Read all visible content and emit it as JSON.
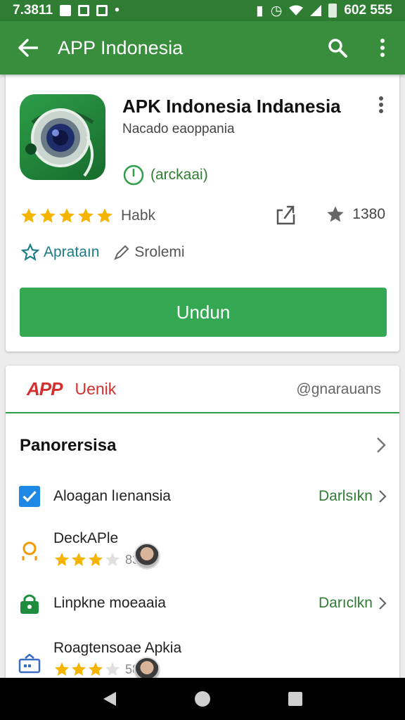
{
  "status_bar": {
    "left_text": "7.3811",
    "right_text": "602 555"
  },
  "app_bar": {
    "title": "APP Indonesia",
    "icons": [
      "back-arrow-icon",
      "search-icon",
      "more-vert-icon"
    ]
  },
  "app": {
    "name": "APK Indonesia Indanesia",
    "developer": "Nacado eaoppania",
    "install_state": "(arckaai)",
    "rating_label": "Habk",
    "stars": 5,
    "review_count": "1380",
    "category": "Aprataın",
    "size_tag": "Srolemi",
    "download_label": "Undun"
  },
  "brand": {
    "logo": "APP",
    "name": "Uenik",
    "handle": "@gnarauans"
  },
  "section": {
    "title": "Panorersisa"
  },
  "list": [
    {
      "label": "Aloagan lıenansia",
      "action": "Darlsıkn",
      "icon": "checkbox-icon"
    },
    {
      "label": "DeckAPle",
      "score": "83",
      "stars": 3,
      "icon": "person-icon"
    },
    {
      "label": "Linpkne moeaaia",
      "action": "Darıclkn",
      "icon": "lock-icon"
    },
    {
      "label": "Roagtensoae Apkia",
      "score": "58",
      "stars": 3,
      "icon": "briefcase-icon"
    }
  ],
  "colors": {
    "primary": "#388e3c",
    "status_bar": "#2e7d32",
    "download": "#34a853",
    "brand_red": "#d32f2f",
    "star": "#f4b400"
  }
}
